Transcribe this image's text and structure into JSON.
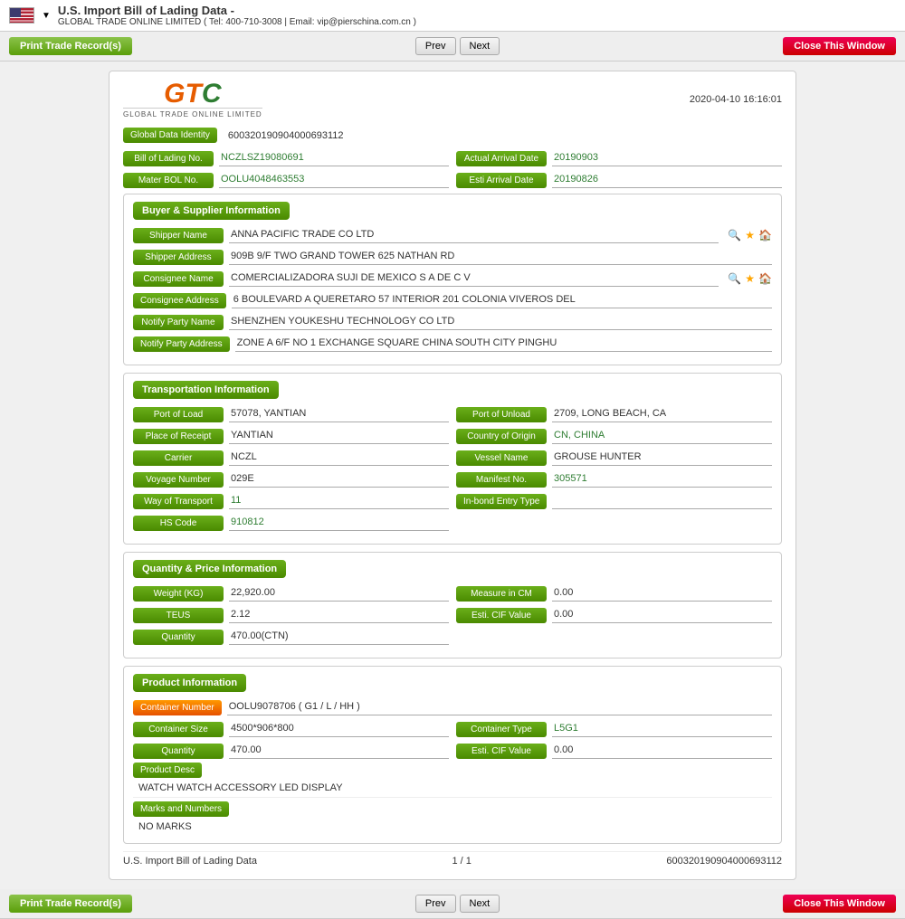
{
  "topbar": {
    "title": "U.S. Import Bill of Lading Data  -",
    "subtitle": "GLOBAL TRADE ONLINE LIMITED ( Tel: 400-710-3008 | Email: vip@pierschina.com.cn )"
  },
  "actions": {
    "print_label": "Print Trade Record(s)",
    "prev_label": "Prev",
    "next_label": "Next",
    "close_label": "Close This Window"
  },
  "document": {
    "logo_main": "GTC",
    "logo_sub": "GLOBAL TRADE ONLINE LIMITED",
    "date": "2020-04-10 16:16:01",
    "global_data_identity_label": "Global Data Identity",
    "global_data_identity_value": "600320190904000693112",
    "bol_label": "Bill of Lading No.",
    "bol_value": "NCZLSZ19080691",
    "actual_arrival_label": "Actual Arrival Date",
    "actual_arrival_value": "20190903",
    "mater_bol_label": "Mater BOL No.",
    "mater_bol_value": "OOLU4048463553",
    "esti_arrival_label": "Esti Arrival Date",
    "esti_arrival_value": "20190826"
  },
  "buyer_supplier": {
    "section_title": "Buyer & Supplier Information",
    "shipper_name_label": "Shipper Name",
    "shipper_name_value": "ANNA PACIFIC TRADE CO LTD",
    "shipper_address_label": "Shipper Address",
    "shipper_address_value": "909B 9/F TWO GRAND TOWER 625 NATHAN RD",
    "consignee_name_label": "Consignee Name",
    "consignee_name_value": "COMERCIALIZADORA SUJI DE MEXICO S A DE C V",
    "consignee_address_label": "Consignee Address",
    "consignee_address_value": "6 BOULEVARD A QUERETARO 57 INTERIOR 201 COLONIA VIVEROS DEL",
    "notify_party_label": "Notify Party Name",
    "notify_party_value": "SHENZHEN YOUKESHU TECHNOLOGY CO LTD",
    "notify_party_address_label": "Notify Party Address",
    "notify_party_address_value": "ZONE A 6/F NO 1 EXCHANGE SQUARE CHINA SOUTH CITY PINGHU"
  },
  "transportation": {
    "section_title": "Transportation Information",
    "port_of_load_label": "Port of Load",
    "port_of_load_value": "57078, YANTIAN",
    "port_of_unload_label": "Port of Unload",
    "port_of_unload_value": "2709, LONG BEACH, CA",
    "place_of_receipt_label": "Place of Receipt",
    "place_of_receipt_value": "YANTIAN",
    "country_of_origin_label": "Country of Origin",
    "country_of_origin_value": "CN, CHINA",
    "carrier_label": "Carrier",
    "carrier_value": "NCZL",
    "vessel_name_label": "Vessel Name",
    "vessel_name_value": "GROUSE HUNTER",
    "voyage_number_label": "Voyage Number",
    "voyage_number_value": "029E",
    "manifest_no_label": "Manifest No.",
    "manifest_no_value": "305571",
    "way_of_transport_label": "Way of Transport",
    "way_of_transport_value": "11",
    "in_bond_entry_label": "In-bond Entry Type",
    "in_bond_entry_value": "",
    "hs_code_label": "HS Code",
    "hs_code_value": "910812"
  },
  "quantity_price": {
    "section_title": "Quantity & Price Information",
    "weight_label": "Weight (KG)",
    "weight_value": "22,920.00",
    "measure_cm_label": "Measure in CM",
    "measure_cm_value": "0.00",
    "teus_label": "TEUS",
    "teus_value": "2.12",
    "esti_cif_label": "Esti. CIF Value",
    "esti_cif_value": "0.00",
    "quantity_label": "Quantity",
    "quantity_value": "470.00(CTN)"
  },
  "product": {
    "section_title": "Product Information",
    "container_number_label": "Container Number",
    "container_number_value": "OOLU9078706 ( G1 / L / HH )",
    "container_size_label": "Container Size",
    "container_size_value": "4500*906*800",
    "container_type_label": "Container Type",
    "container_type_value": "L5G1",
    "quantity_label": "Quantity",
    "quantity_value": "470.00",
    "esti_cif_label": "Esti. CIF Value",
    "esti_cif_value": "0.00",
    "product_desc_label": "Product Desc",
    "product_desc_value": "WATCH WATCH ACCESSORY LED DISPLAY",
    "marks_numbers_label": "Marks and Numbers",
    "marks_numbers_value": "NO MARKS"
  },
  "footer": {
    "left": "U.S. Import Bill of Lading Data",
    "center": "1 / 1",
    "right": "600320190904000693112"
  },
  "bottom_actions": {
    "print_label": "Print Trade Record(s)",
    "prev_label": "Prev",
    "next_label": "Next",
    "close_label": "Close This Window"
  }
}
